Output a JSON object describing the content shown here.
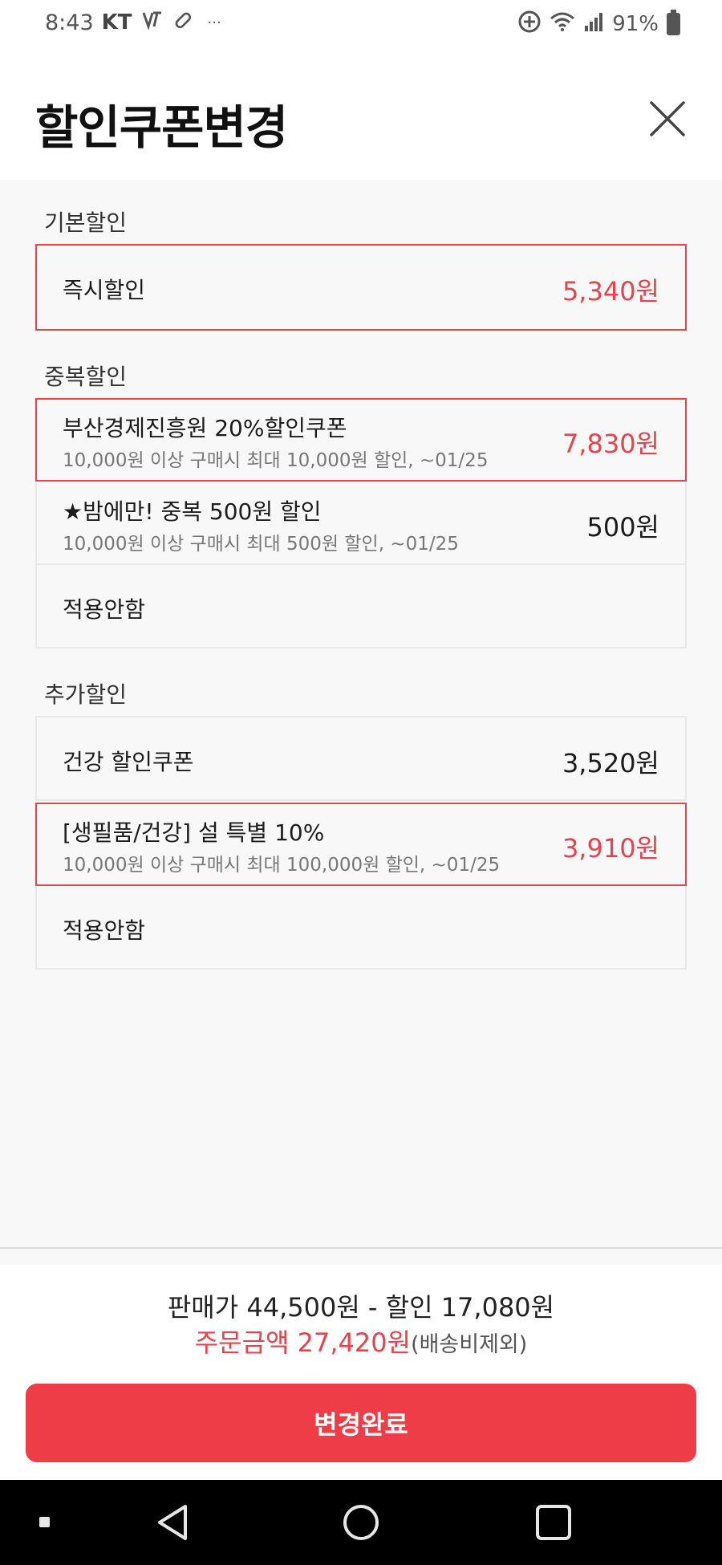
{
  "status_bar": {
    "time": "8:43",
    "carrier": "KT",
    "more": "···",
    "battery_percent": "91%"
  },
  "header": {
    "title": "할인쿠폰변경"
  },
  "sections": {
    "basic": {
      "title": "기본할인",
      "options": [
        {
          "name": "즉시할인",
          "price": "5,340원",
          "selected": true
        }
      ]
    },
    "duplicate": {
      "title": "중복할인",
      "options": [
        {
          "name": "부산경제진흥원 20%할인쿠폰",
          "desc": "10,000원 이상 구매시 최대 10,000원 할인, ~01/25",
          "price": "7,830원",
          "selected": true
        },
        {
          "name": "★밤에만! 중복 500원 할인",
          "desc": "10,000원 이상 구매시 최대 500원 할인, ~01/25",
          "price": "500원",
          "selected": false
        },
        {
          "name": "적용안함",
          "selected": false
        }
      ]
    },
    "additional": {
      "title": "추가할인",
      "options": [
        {
          "name": "건강 할인쿠폰",
          "price": "3,520원",
          "selected": false
        },
        {
          "name": "[생필품/건강] 설 특별 10%",
          "desc": "10,000원 이상 구매시 최대 100,000원 할인, ~01/25",
          "price": "3,910원",
          "selected": true
        },
        {
          "name": "적용안함",
          "selected": false
        }
      ]
    }
  },
  "footer": {
    "summary_line": "판매가 44,500원 - 할인 17,080원",
    "order_amount": "주문금액 27,420원",
    "shipping_note": "(배송비제외)",
    "confirm_label": "변경완료"
  },
  "colors": {
    "accent": "#e8434c",
    "button": "#ee3d46",
    "nav_bar": "#000000"
  }
}
